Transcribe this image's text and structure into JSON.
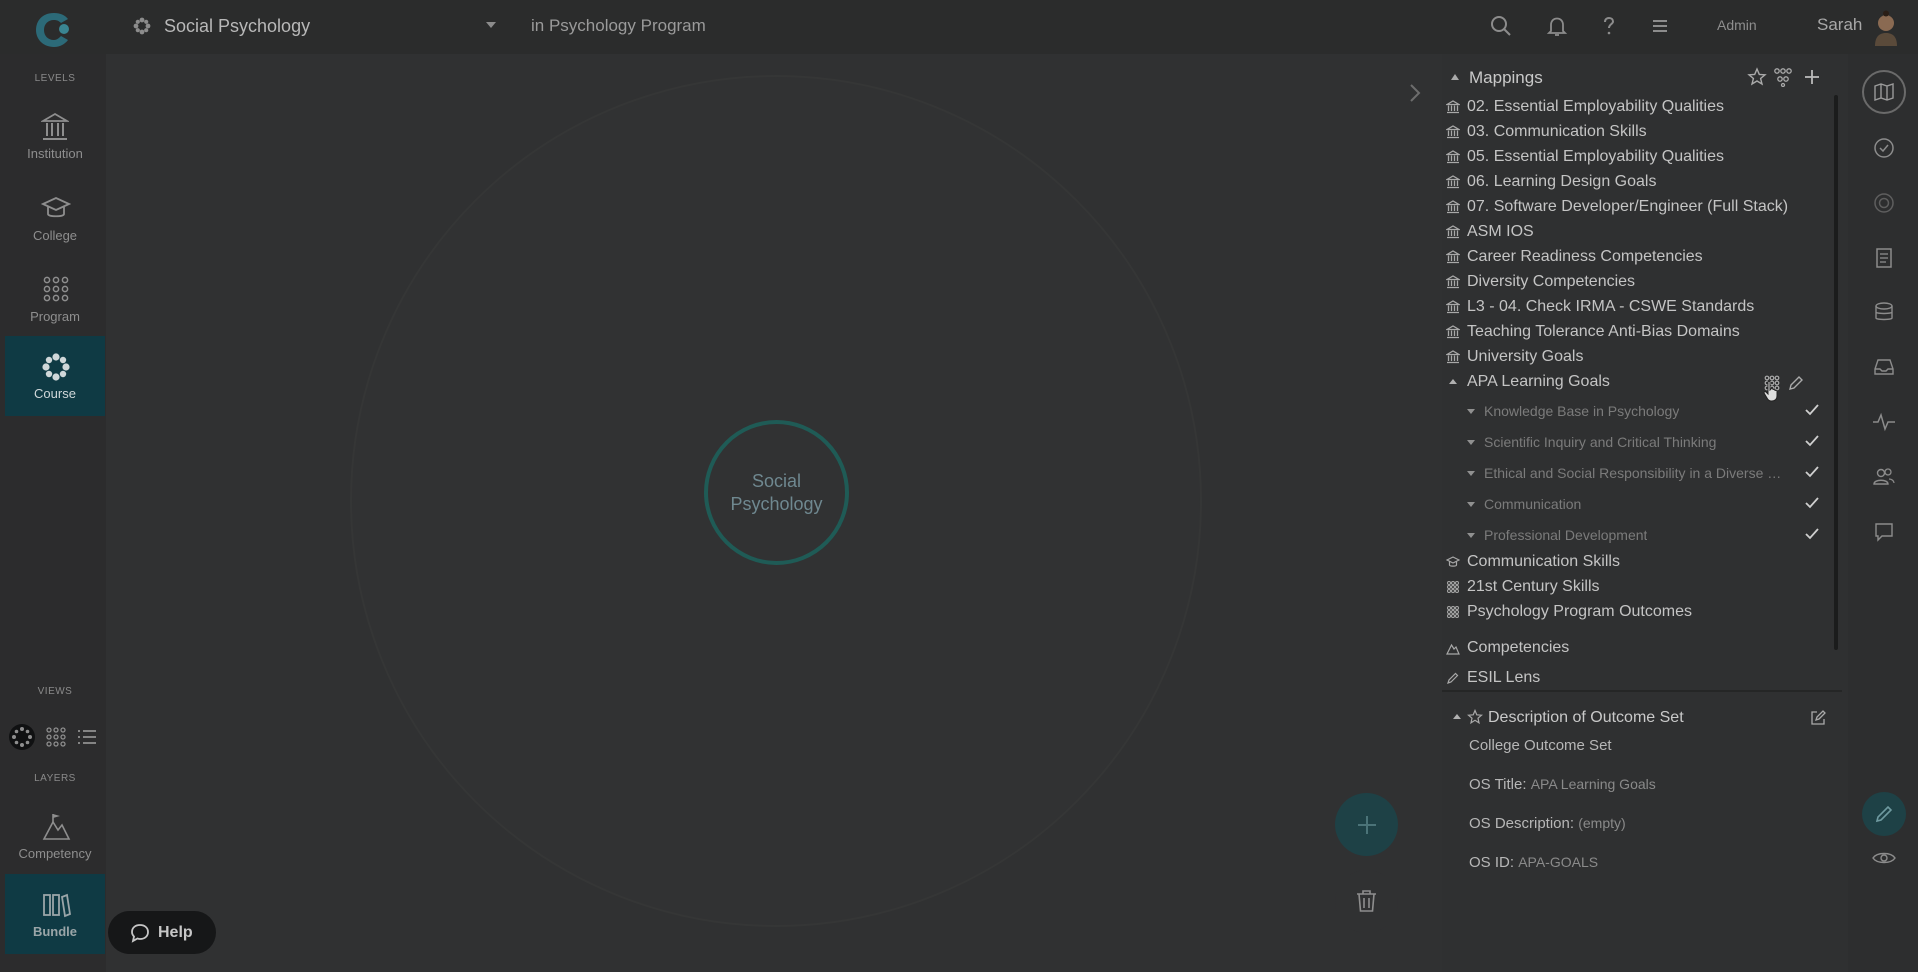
{
  "header": {
    "course_name": "Social Psychology",
    "program_context": "in Psychology Program",
    "admin_label": "Admin",
    "user_name": "Sarah"
  },
  "sidebar": {
    "levels_label": "LEVELS",
    "levels": [
      {
        "label": "Institution",
        "icon": "institution-icon"
      },
      {
        "label": "College",
        "icon": "graduation-cap-icon"
      },
      {
        "label": "Program",
        "icon": "dot-grid-icon"
      },
      {
        "label": "Course",
        "icon": "flower-icon",
        "active": true
      }
    ],
    "views_label": "VIEWS",
    "views": [
      "radial-view-icon",
      "grid-view-icon",
      "list-view-icon"
    ],
    "layers_label": "LAYERS",
    "layers": [
      {
        "label": "Competency",
        "icon": "competency-icon"
      },
      {
        "label": "Bundle",
        "icon": "bundle-icon"
      }
    ]
  },
  "canvas": {
    "hub_line1": "Social",
    "hub_line2": "Psychology"
  },
  "help": {
    "label": "Help"
  },
  "mappings": {
    "title": "Mappings",
    "items": [
      "02. Essential Employability Qualities",
      "03. Communication Skills",
      "05. Essential Employability Qualities",
      "06. Learning Design Goals",
      "07. Software Developer/Engineer (Full Stack)",
      "ASM IOS",
      "Career Readiness Competencies",
      "Diversity Competencies",
      "L3 - 04. Check IRMA - CSWE Standards",
      "Teaching Tolerance Anti-Bias Domains",
      "University Goals"
    ],
    "expanded": {
      "title": "APA Learning Goals",
      "children": [
        "Knowledge Base in Psychology",
        "Scientific Inquiry and Critical Thinking",
        "Ethical and Social Responsibility in a Diverse World",
        "Communication",
        "Professional Development"
      ]
    },
    "more": [
      "Communication Skills",
      "21st Century Skills",
      "Psychology Program Outcomes"
    ],
    "competencies": "Competencies",
    "esil": "ESIL Lens"
  },
  "description": {
    "title": "Description of Outcome Set",
    "set_type": "College Outcome Set",
    "title_label": "OS Title:",
    "title_value": "APA Learning Goals",
    "desc_label": "OS Description:",
    "desc_value": "(empty)",
    "id_label": "OS ID:",
    "id_value": "APA-GOALS"
  }
}
